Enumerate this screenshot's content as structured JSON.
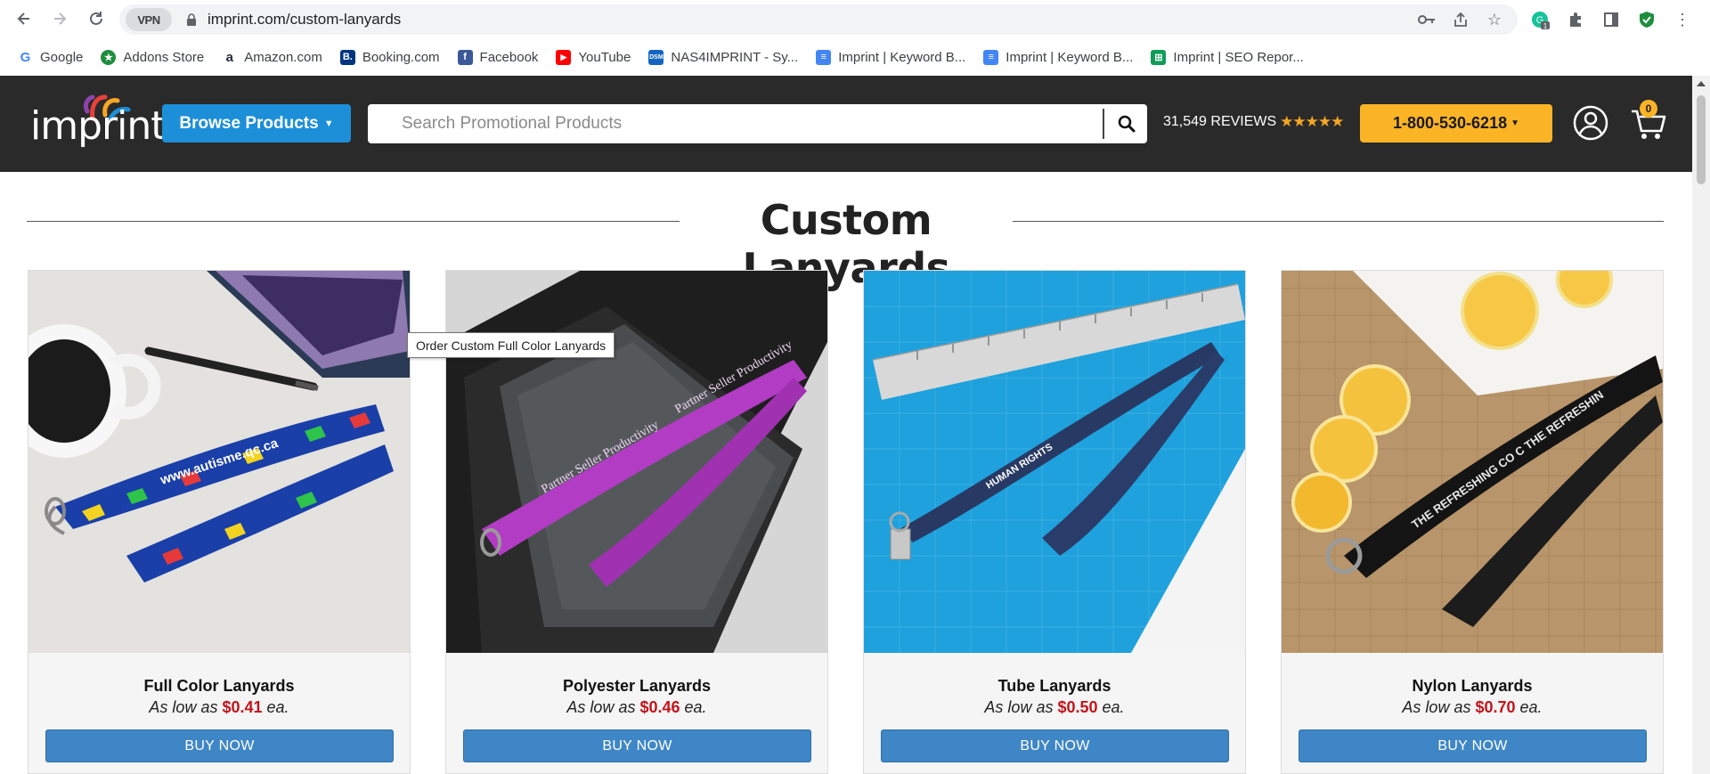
{
  "browser": {
    "vpn_label": "VPN",
    "url": "imprint.com/custom-lanyards",
    "bookmarks": [
      {
        "label": "Google",
        "icon": "google-icon",
        "color": "#4285f4"
      },
      {
        "label": "Addons Store",
        "icon": "addons-store-icon",
        "color": "#1e8e3e"
      },
      {
        "label": "Amazon.com",
        "icon": "amazon-icon",
        "color": "#232f3e"
      },
      {
        "label": "Booking.com",
        "icon": "booking-icon",
        "color": "#003580"
      },
      {
        "label": "Facebook",
        "icon": "facebook-icon",
        "color": "#3b5998"
      },
      {
        "label": "YouTube",
        "icon": "youtube-icon",
        "color": "#ff0000"
      },
      {
        "label": "NAS4IMPRINT - Sy...",
        "icon": "nas-icon",
        "color": "#1565c0"
      },
      {
        "label": "Imprint | Keyword B...",
        "icon": "docs-icon",
        "color": "#4285f4"
      },
      {
        "label": "Imprint | Keyword B...",
        "icon": "docs-icon",
        "color": "#4285f4"
      },
      {
        "label": "Imprint | SEO Repor...",
        "icon": "sheets-icon",
        "color": "#0f9d58"
      }
    ],
    "ext_badge": "1"
  },
  "header": {
    "logo_text": "imprint",
    "browse_label": "Browse Products",
    "search_placeholder": "Search Promotional Products",
    "reviews_label": "31,549 REVIEWS",
    "stars": "★★★★★",
    "phone": "1-800-530-6218",
    "cart_count": "0",
    "colors": {
      "header_bg": "#2a2a2a",
      "browse_bg": "#1c8fd8",
      "phone_bg": "#fbb426"
    }
  },
  "page": {
    "title": "Custom Lanyards",
    "tooltip": "Order Custom Full Color Lanyards",
    "price_prefix": "As low as",
    "price_suffix": "ea."
  },
  "products": [
    {
      "name": "Full Color Lanyards",
      "price": "$0.41",
      "button": "BUY NOW"
    },
    {
      "name": "Polyester Lanyards",
      "price": "$0.46",
      "button": "BUY NOW"
    },
    {
      "name": "Tube Lanyards",
      "price": "$0.50",
      "button": "BUY NOW"
    },
    {
      "name": "Nylon Lanyards",
      "price": "$0.70",
      "button": "BUY NOW"
    }
  ]
}
